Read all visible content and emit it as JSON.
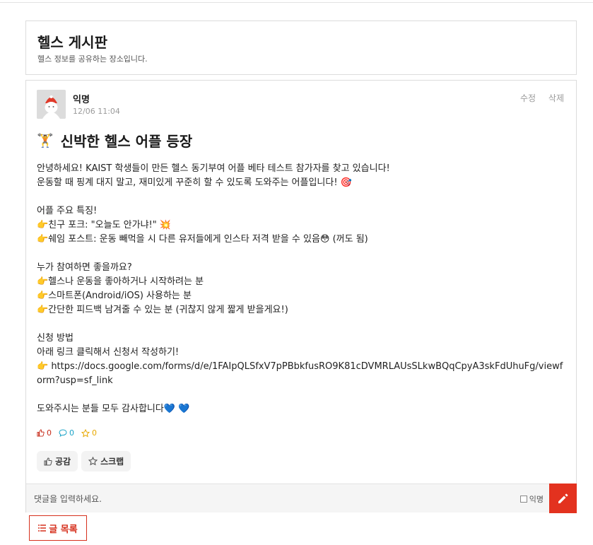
{
  "board": {
    "title": "헬스 게시판",
    "subtitle": "헬스 정보를 공유하는 장소입니다."
  },
  "post": {
    "author": "익명",
    "date": "12/06 11:04",
    "edit_label": "수정",
    "delete_label": "삭제",
    "title_emoji": "🏋️",
    "title": "신박한 헬스 어플 등장",
    "body": "안녕하세요! KAIST 학생들이 만든 헬스 동기부여 어플 베타 테스트 참가자를 찾고 있습니다!\n운동할 때 핑계 대지 말고, 재미있게 꾸준히 할 수 있도록 도와주는 어플입니다! 🎯\n\n어플 주요 특징!\n👉친구 포크: \"오늘도 안가냐!\" 💥\n👉쉐임 포스트: 운동 빼먹을 시 다른 유저들에게 인스타 저격 받을 수 있음😳 (꺼도 됨)\n\n누가 참여하면 좋을까요?\n👉헬스나 운동을 좋아하거나 시작하려는 분\n👉스마트폰(Android/iOS) 사용하는 분\n👉간단한 피드백 남겨줄 수 있는 분 (귀찮지 않게 짧게 받을게요!)\n\n신청 방법\n아래 링크 클릭해서 신청서 작성하기!\n👉 https://docs.google.com/forms/d/e/1FAIpQLSfxV7pPBbkfusRO9K81cDVMRLAUsSLkwBQqCpyA3skFdUhuFg/viewform?usp=sf_link\n\n도와주시는 분들 모두 감사합니다💙 💙",
    "likes": "0",
    "comments": "0",
    "scraps": "0",
    "like_button": "공감",
    "scrap_button": "스크랩"
  },
  "comment": {
    "placeholder": "댓글을 입력하세요.",
    "anon_label": "익명"
  },
  "list_button": "글 목록",
  "colors": {
    "accent": "#e3321f",
    "like": "#c62917",
    "comment": "#1aa3c7",
    "scrap": "#e8a800"
  },
  "icons": [
    "avatar-default-icon",
    "thumbs-up-icon",
    "speech-bubble-icon",
    "star-icon",
    "pencil-icon",
    "list-icon"
  ]
}
